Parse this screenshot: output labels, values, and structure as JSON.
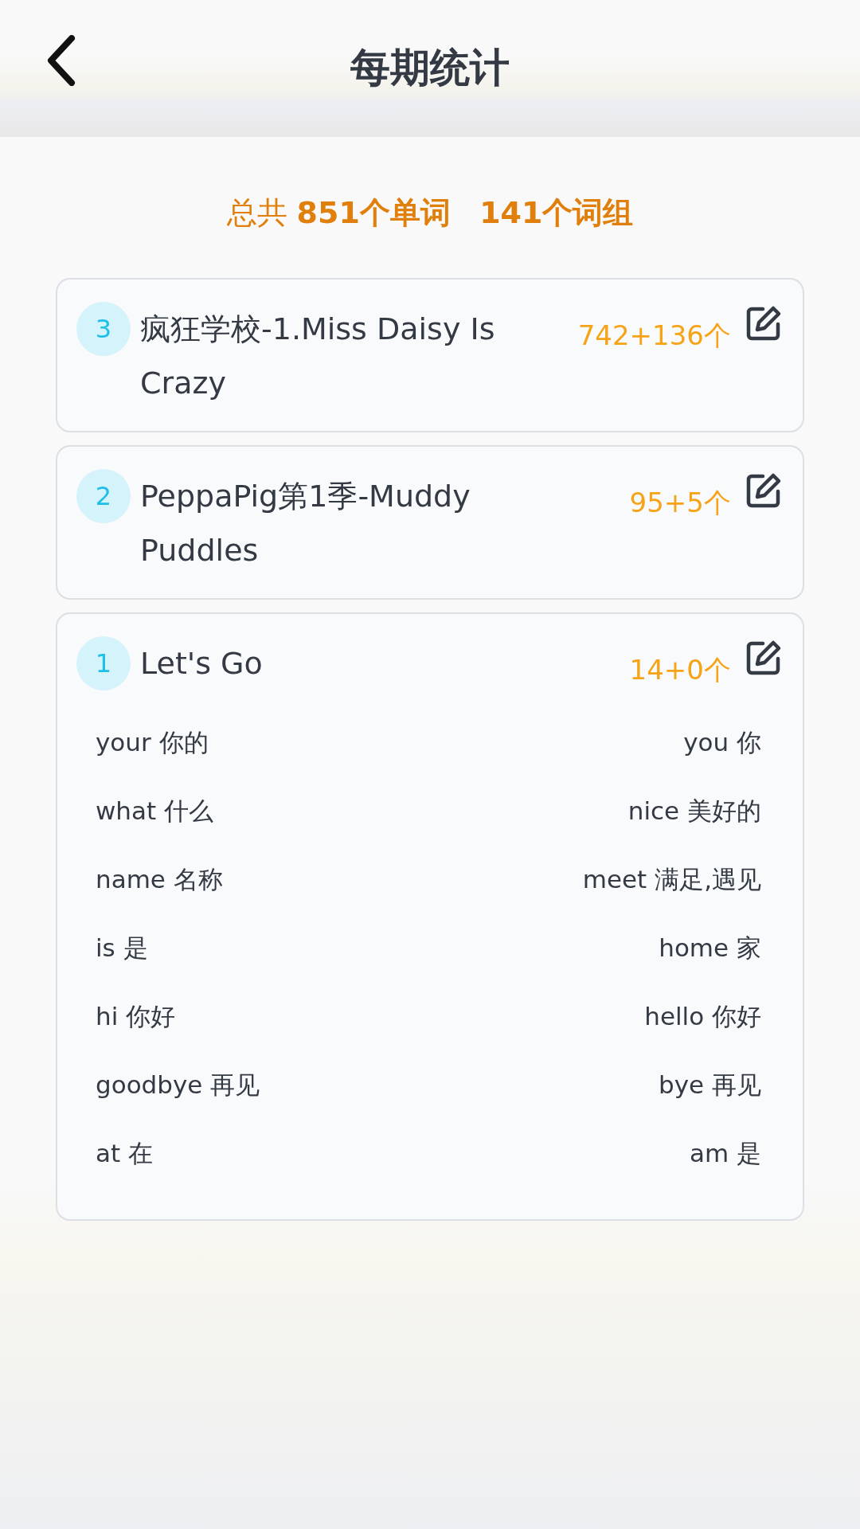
{
  "header": {
    "title": "每期统计"
  },
  "summary": "总共 **851个单词**   **141个词组**",
  "issues": [
    {
      "number": "3",
      "title": "疯狂学校-1.Miss Daisy Is Crazy",
      "count": "742+136个"
    },
    {
      "number": "2",
      "title": "PeppaPig第1季-Muddy Puddles",
      "count": "95+5个"
    },
    {
      "number": "1",
      "title": "Let's Go",
      "count": "14+0个",
      "words": [
        {
          "left": "your 你的",
          "right": "you 你"
        },
        {
          "left": "what 什么",
          "right": "nice 美好的"
        },
        {
          "left": "name 名称",
          "right": "meet 满足,遇见"
        },
        {
          "left": "is 是",
          "right": "home 家"
        },
        {
          "left": "hi 你好",
          "right": "hello 你好"
        },
        {
          "left": "goodbye 再见",
          "right": "bye 再见"
        },
        {
          "left": "at 在",
          "right": "am 是"
        }
      ]
    }
  ]
}
